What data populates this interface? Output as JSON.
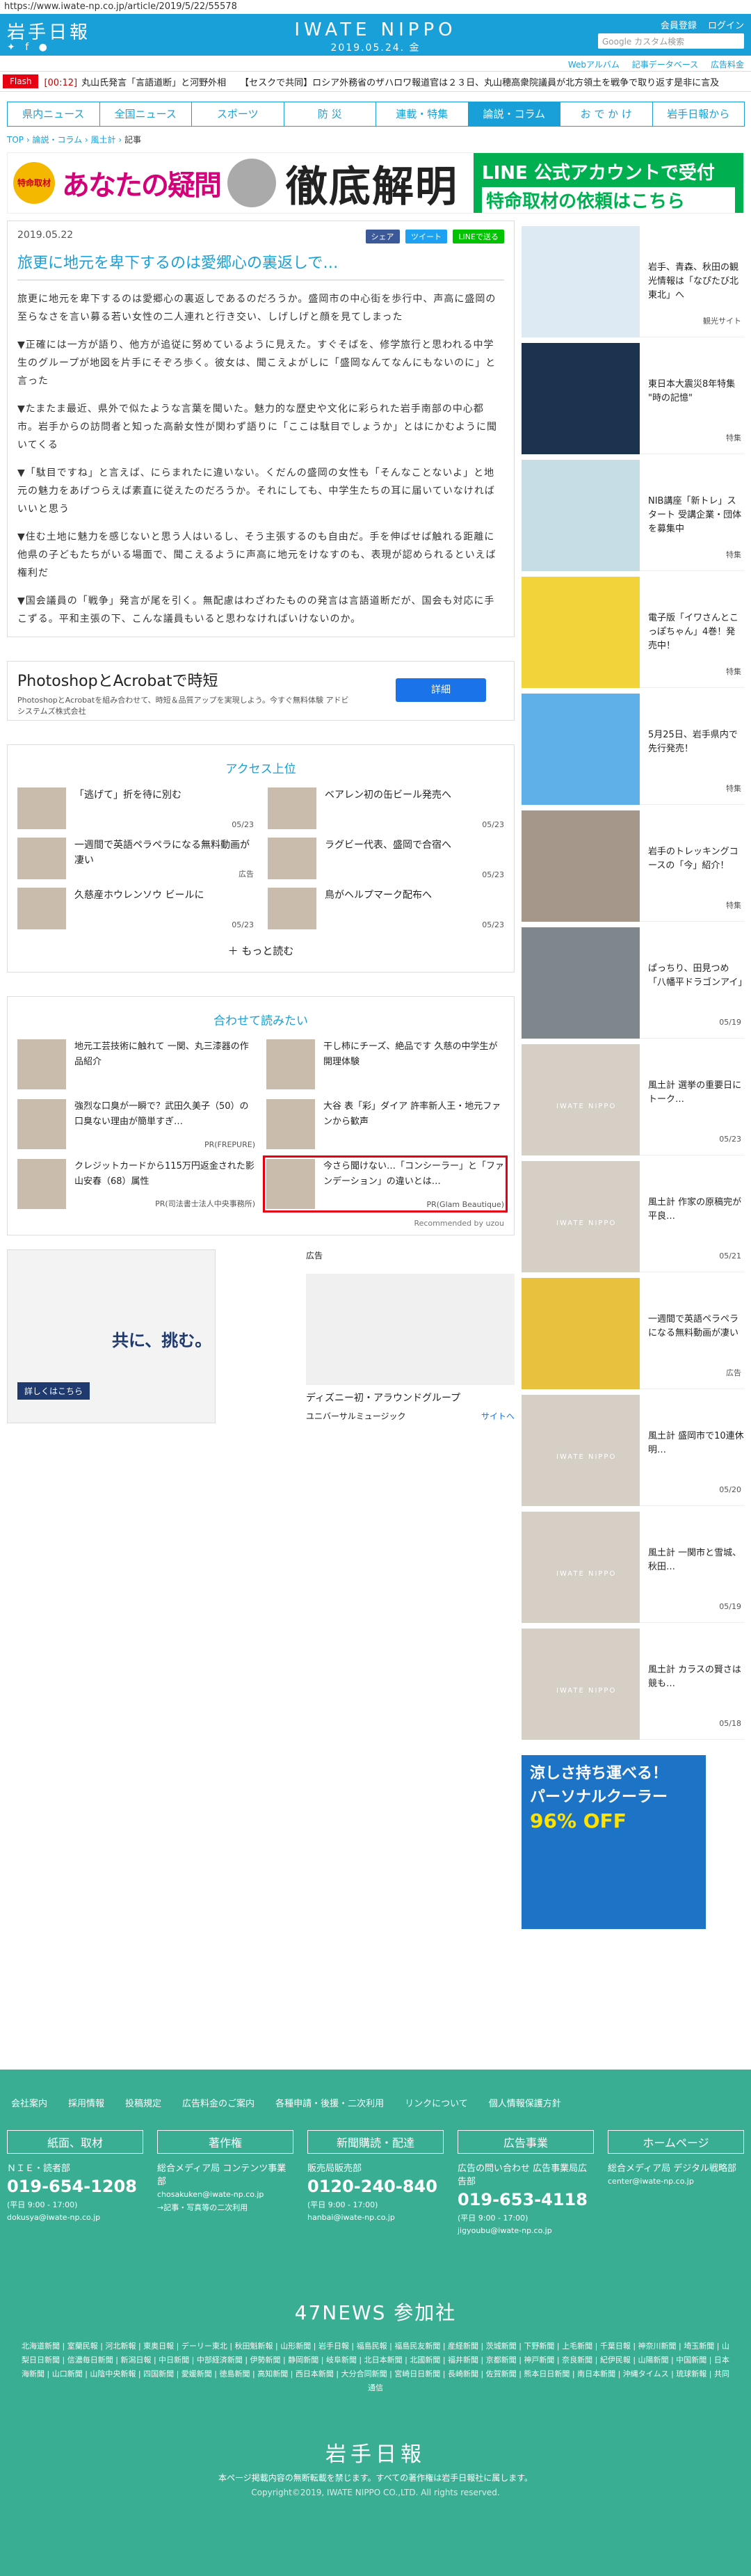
{
  "url": "https://www.iwate-np.co.jp/article/2019/5/22/55578",
  "header": {
    "logo": "岩手日報",
    "brand": "IWATE NIPPO",
    "date": "2019.05.24. 金",
    "member_register": "会員登録",
    "login": "ログイン",
    "search_placeholder": "Google カスタム検索",
    "sub_links": [
      "Webアルバム",
      "記事データベース",
      "広告料金"
    ]
  },
  "flash": {
    "label": "Flash",
    "items": [
      {
        "time": "[00:12]",
        "text": "丸山氏発言「言語道断」と河野外相"
      },
      {
        "time": "",
        "text": "【セスクで共同】ロシア外務省のザハロワ報道官は２３日、丸山穂高衆院議員が北方領土を戦争で取り返す是非に言及"
      }
    ]
  },
  "nav": [
    "県内ニュース",
    "全国ニュース",
    "スポーツ",
    "防 災",
    "連載・特集",
    "論説・コラム",
    "お で か け",
    "岩手日報から"
  ],
  "breadcrumb": [
    "TOP",
    "論説・コラム",
    "風土計",
    "記事"
  ],
  "banner": {
    "badge": "特命取材",
    "title1": "あなたの疑問",
    "title2": "徹底解明",
    "right1": "LINE 公式アカウントで受付",
    "right2": "特命取材の依頼はこちら"
  },
  "article": {
    "date": "2019.05.22",
    "share": [
      "シェア",
      "ツイート",
      "LINEで送る"
    ],
    "title": "旅更に地元を卑下するのは愛郷心の裏返しで…",
    "paragraphs": [
      "旅更に地元を卑下するのは愛郷心の裏返しであるのだろうか。盛岡市の中心街を歩行中、声高に盛岡の至らなさを言い募る若い女性の二人連れと行き交い、しげしげと顔を見てしまった",
      "▼正確には一方が語り、他方が追従に努めているように見えた。すぐそばを、修学旅行と思われる中学生のグループが地図を片手にそぞろ歩く。彼女は、聞こえよがしに「盛岡なんてなんにもないのに」と言った",
      "▼たまたま最近、県外で似たような言葉を聞いた。魅力的な歴史や文化に彩られた岩手南部の中心都市。岩手からの訪問者と知った高齢女性が関わず語りに「ここは駄目でしょうか」とはにかむように聞いてくる",
      "▼「駄目ですね」と言えば、にらまれたに違いない。くだんの盛岡の女性も「そんなことないよ」と地元の魅力をあげつらえば素直に従えたのだろうか。それにしても、中学生たちの耳に届いていなければいいと思う",
      "▼住む土地に魅力を感じないと思う人はいるし、そう主張するのも自由だ。手を伸ばせば触れる距離に他県の子どもたちがいる場面で、聞こえるように声高に地元をけなすのも、表現が認められるといえば権利だ",
      "▼国会議員の「戦争」発言が尾を引く。無配慮はわざわたものの発言は言語道断だが、国会も対応に手こずる。平和主張の下、こんな議員もいると思わなければいけないのか。"
    ]
  },
  "adbox": {
    "headline": "PhotoshopとAcrobatで時短",
    "sub": "PhotoshopとAcrobatを組み合わせて、時短＆品質アップを実現しよう。今すぐ無料体験 アドビ システムズ株式会社",
    "button": "詳細"
  },
  "ranking": {
    "title": "アクセス上位",
    "items": [
      {
        "text": "「逃げて」折を待に別む",
        "date": "05/23"
      },
      {
        "text": "ベアレン初の缶ビール発売へ",
        "date": "05/23"
      },
      {
        "text": "一週間で英語ペラペラになる無料動画が凄い",
        "date": "広告"
      },
      {
        "text": "ラグビー代表、盛岡で合宿へ",
        "date": "05/23"
      },
      {
        "text": "久慈産ホウレンソウ ビールに",
        "date": "05/23"
      },
      {
        "text": "鳥がヘルプマーク配布へ",
        "date": "05/23"
      }
    ],
    "more": "もっと読む"
  },
  "related": {
    "title": "合わせて読みたい",
    "items": [
      {
        "text": "地元工芸技術に触れて 一関、丸三漆器の作品紹介",
        "src": ""
      },
      {
        "text": "干し柿にチーズ、絶品です 久慈の中学生が開理体験",
        "src": ""
      },
      {
        "text": "強烈な口臭が一瞬で？武田久美子（50）の口臭ない理由が簡単すぎ…",
        "src": "PR(FREPURE)"
      },
      {
        "text": "大谷 表「彩」ダイア 許率新人王・地元ファンから歓声",
        "src": ""
      },
      {
        "text": "クレジットカードから115万円返金された影山安春（68）属性",
        "src": "PR(司法書士法人中央事務所)"
      },
      {
        "text": "今さら聞けない…「コンシーラー」と「ファンデーション」の違いとは…",
        "src": "PR(Glam Beautique)"
      }
    ],
    "recommended": "Recommended by uzou"
  },
  "ads": {
    "ad1_text": "共に、挑む。",
    "ad1_btn": "詳しくはこちら",
    "ad2_label": "広告",
    "ad2_name": "ディズニー初・アラウンドグループ",
    "ad2_brand": "ユニバーサルミュージック",
    "ad2_site": "サイトへ"
  },
  "sidebar": [
    {
      "text": "岩手、青森、秋田の観光情報は「なぴたび北東北」へ",
      "date": "観光サイト"
    },
    {
      "text": "東日本大震災8年特集 \"時の記憶\"",
      "date": "特集"
    },
    {
      "text": "NIB講座「新トレ」スタート 受講企業・団体を募集中",
      "date": "特集"
    },
    {
      "text": "電子版「イワさんとこっぽちゃん」4巻！発売中！",
      "date": "特集"
    },
    {
      "text": "5月25日、岩手県内で先行発売！",
      "date": "特集"
    },
    {
      "text": "岩手のトレッキングコースの「今」紹介！",
      "date": "特集"
    },
    {
      "text": "ぱっちり、田見つめ 「八幡平ドラゴンアイ」",
      "date": "05/19"
    },
    {
      "text": "風土計 選挙の重要日にトーク…",
      "date": "05/23"
    },
    {
      "text": "風土計 作家の原稿完が平良…",
      "date": "05/21"
    },
    {
      "text": "一週間で英語ペラペラになる無料動画が凄い",
      "date": "広告"
    },
    {
      "text": "風土計 盛岡市で10連休明…",
      "date": "05/20"
    },
    {
      "text": "風土計 一関市と雪城、秋田…",
      "date": "05/19"
    },
    {
      "text": "風土計 カラスの賢さは競も…",
      "date": "05/18"
    }
  ],
  "sidead": {
    "l1": "涼しさ持ち運べる！",
    "l2": "パーソナルクーラー",
    "l3": "96% OFF"
  },
  "footer": {
    "links": [
      "会社案内",
      "採用情報",
      "投稿規定",
      "広告料金のご案内",
      "各種申請・後援・二次利用",
      "リンクについて",
      "個人情報保護方針"
    ],
    "cols": [
      {
        "h": "紙面、取材",
        "t": "ＮＩＥ・読者部",
        "tel": "019-654-1208",
        "sm": "(平日 9:00 - 17:00)",
        "mail": "dokusya@iwate-np.co.jp"
      },
      {
        "h": "著作権",
        "t": "総合メディア局 コンテンツ事業部",
        "tel": "",
        "sm": "chosakuken@iwate-np.co.jp",
        "mail": "→記事・写真等の二次利用"
      },
      {
        "h": "新聞購読・配達",
        "t": "販売局販売部",
        "tel": "0120-240-840",
        "sm": "(平日 9:00 - 17:00)",
        "mail": "hanbai@iwate-np.co.jp"
      },
      {
        "h": "広告事業",
        "t": "広告の問い合わせ 広告事業局広告部",
        "tel": "019-653-4118",
        "sm": "(平日 9:00 - 17:00)",
        "mail": "jigyoubu@iwate-np.co.jp"
      },
      {
        "h": "ホームページ",
        "t": "総合メディア局 デジタル戦略部",
        "tel": "",
        "sm": "center@iwate-np.co.jp",
        "mail": ""
      }
    ],
    "news47": "47NEWS 参加社",
    "papers": "北海道新聞 | 室蘭民報 | 河北新報 | 東奥日報 | デーリー東北 | 秋田魁新報 | 山形新聞 | 岩手日報 | 福島民報 | 福島民友新聞 | 産経新聞 | 茨城新聞 | 下野新聞 | 上毛新聞 | 千葉日報 | 神奈川新聞 | 埼玉新聞 | 山梨日日新聞 | 信濃毎日新聞 | 新潟日報 | 中日新聞 | 中部経済新聞 | 伊勢新聞 | 静岡新聞 | 岐阜新聞 | 北日本新聞 | 北國新聞 | 福井新聞 | 京都新聞 | 神戸新聞 | 奈良新聞 | 紀伊民報 | 山陽新聞 | 中国新聞 | 日本海新聞 | 山口新聞 | 山陰中央新報 | 四国新聞 | 愛媛新聞 | 徳島新聞 | 高知新聞 | 西日本新聞 | 大分合同新聞 | 宮崎日日新聞 | 長崎新聞 | 佐賀新聞 | 熊本日日新聞 | 南日本新聞 | 沖縄タイムス | 琉球新報 | 共同通信",
    "logo": "岩手日報",
    "copy1": "本ページ掲載内容の無断転載を禁じます。すべての著作権は岩手日報社に属します。",
    "copy2": "Copyright©2019, IWATE NIPPO CO.,LTD. All rights reserved."
  },
  "colors": {
    "accent": "#1aa0d8",
    "footer": "#3aae92",
    "flash": "#e60012"
  }
}
